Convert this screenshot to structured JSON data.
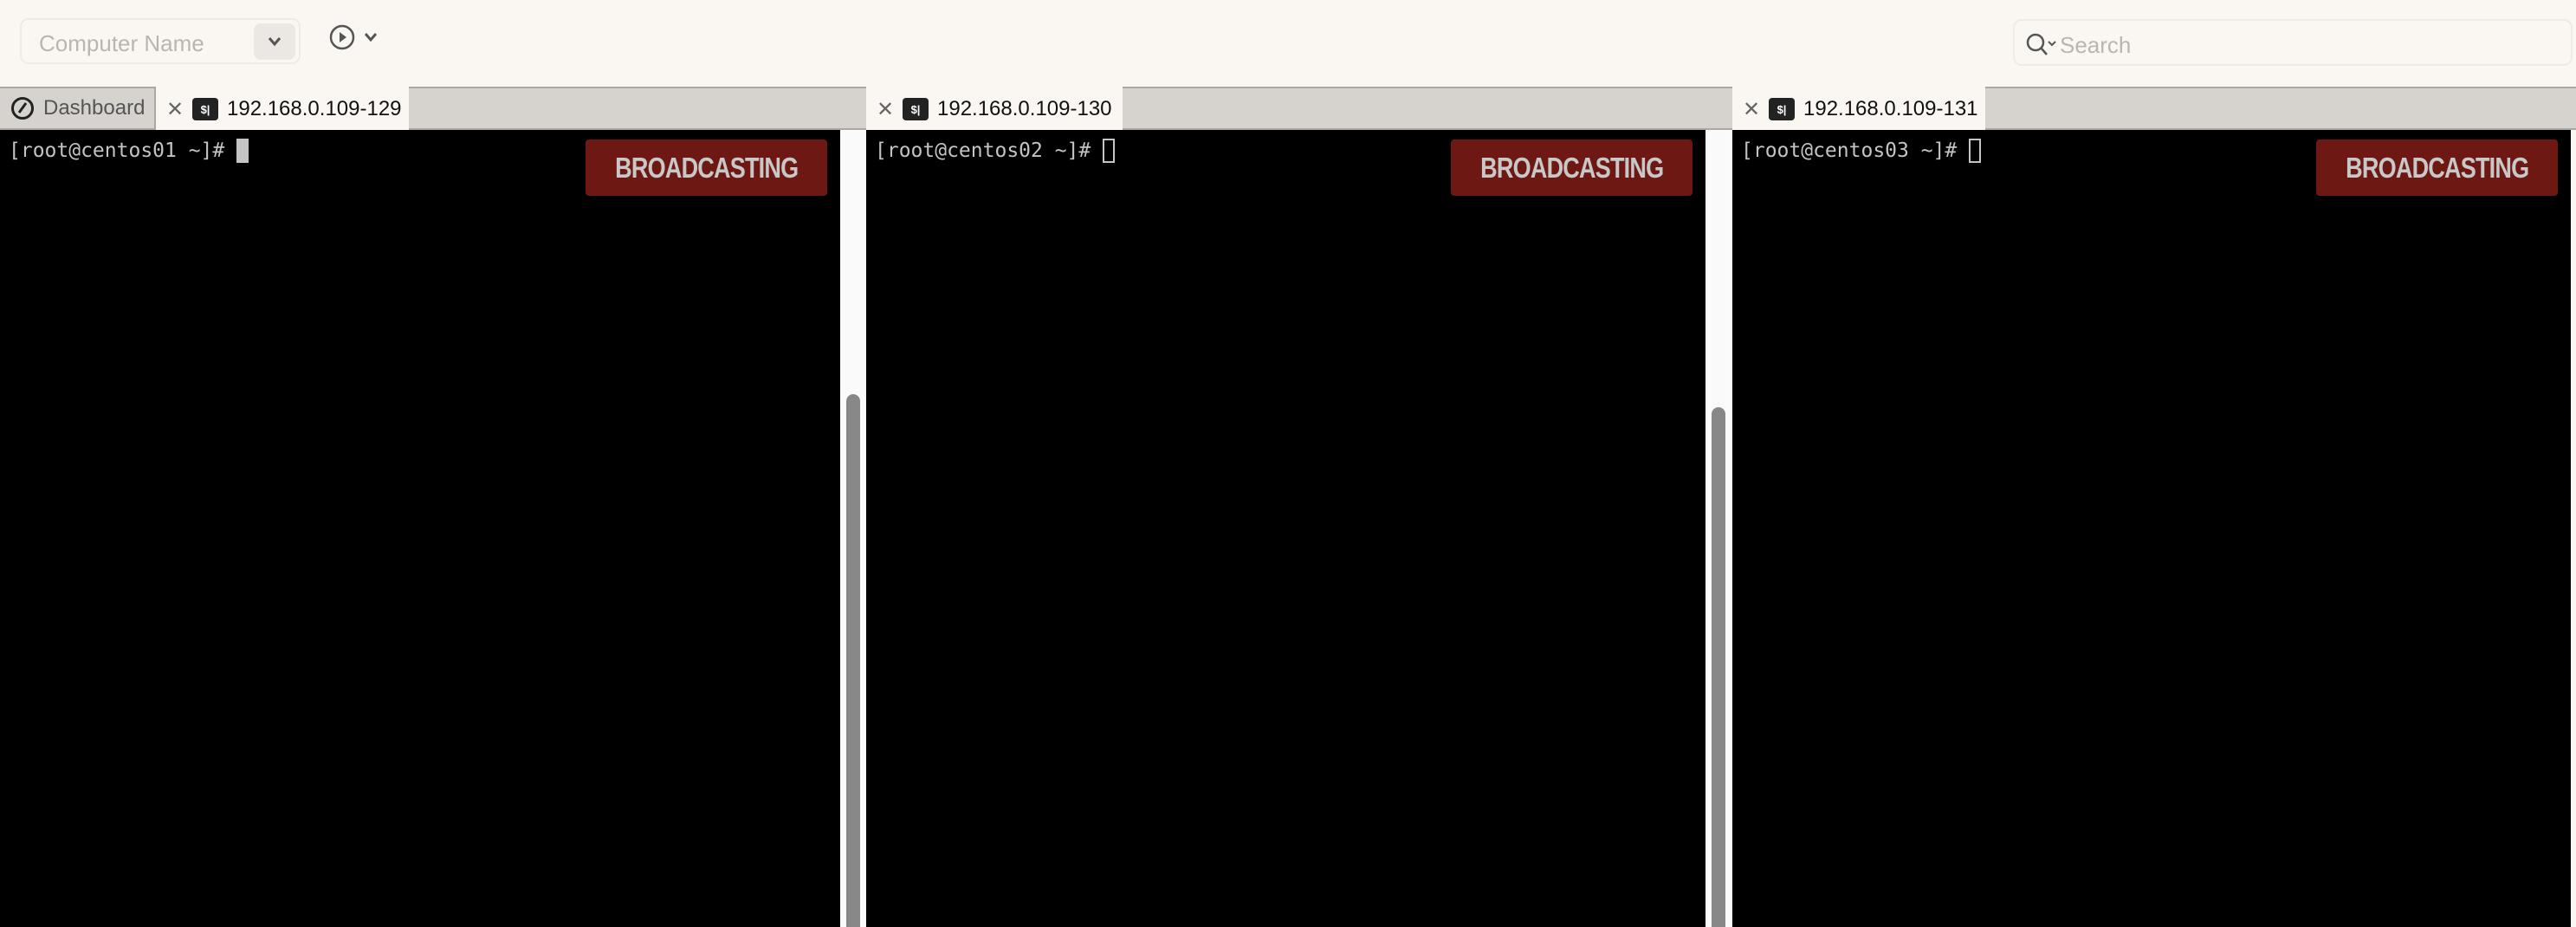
{
  "toolbar": {
    "computer_name_placeholder": "Computer Name",
    "search_placeholder": "Search"
  },
  "dashboard_tab": {
    "label": "Dashboard"
  },
  "panes": [
    {
      "tab_label": "192.168.0.109-129",
      "prompt": "[root@centos01 ~]#",
      "badge": "BROADCASTING",
      "cursor": "solid"
    },
    {
      "tab_label": "192.168.0.109-130",
      "prompt": "[root@centos02 ~]#",
      "badge": "BROADCASTING",
      "cursor": "hollow"
    },
    {
      "tab_label": "192.168.0.109-131",
      "prompt": "[root@centos03 ~]#",
      "badge": "BROADCASTING",
      "cursor": "hollow"
    }
  ],
  "colors": {
    "badge_bg": "#6e1814",
    "terminal_bg": "#000000",
    "toolbar_bg": "#faf7f2"
  },
  "term_icon_text": "$|"
}
